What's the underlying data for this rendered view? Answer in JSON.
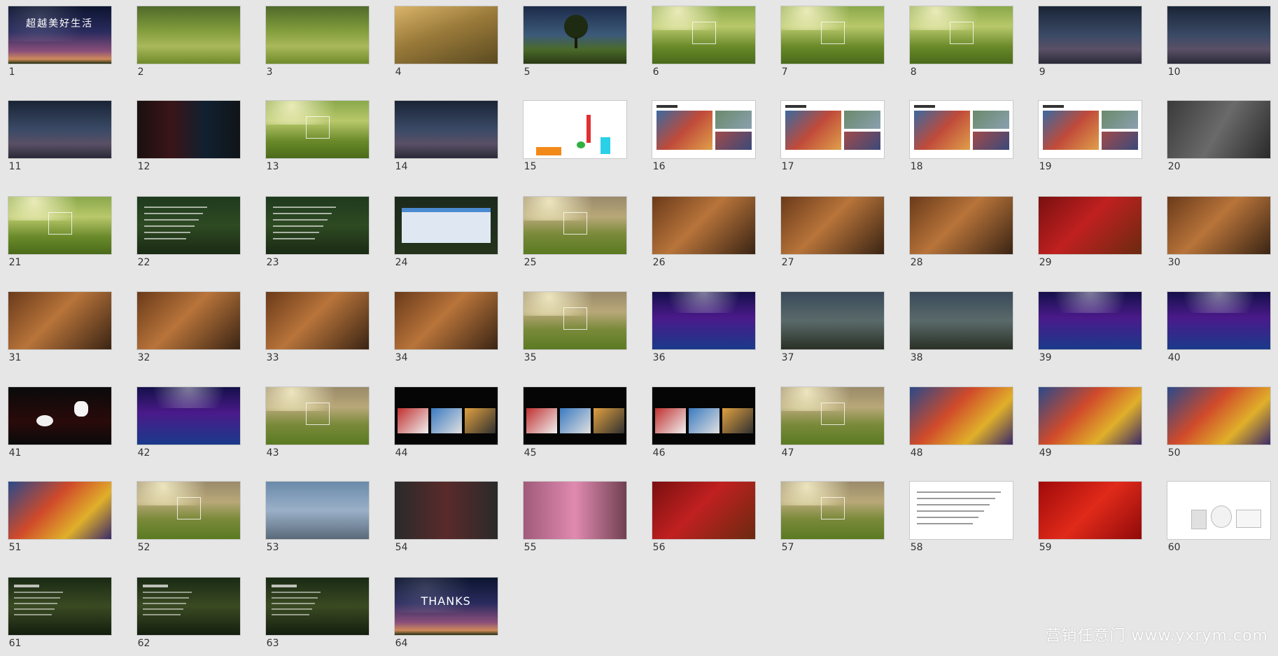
{
  "slides": [
    {
      "n": "1",
      "kind": "night",
      "title": "超越美好生活"
    },
    {
      "n": "2",
      "kind": "park",
      "title": ""
    },
    {
      "n": "3",
      "kind": "park",
      "title": ""
    },
    {
      "n": "4",
      "kind": "autumn",
      "title": ""
    },
    {
      "n": "5",
      "kind": "tree",
      "title": ""
    },
    {
      "n": "6",
      "kind": "forest",
      "title": ""
    },
    {
      "n": "7",
      "kind": "forest",
      "title": ""
    },
    {
      "n": "8",
      "kind": "forest",
      "title": ""
    },
    {
      "n": "9",
      "kind": "city",
      "title": ""
    },
    {
      "n": "10",
      "kind": "city",
      "title": ""
    },
    {
      "n": "11",
      "kind": "city",
      "title": ""
    },
    {
      "n": "12",
      "kind": "darkposter",
      "title": ""
    },
    {
      "n": "13",
      "kind": "forest",
      "title": ""
    },
    {
      "n": "14",
      "kind": "city",
      "title": ""
    },
    {
      "n": "15",
      "kind": "map",
      "title": ""
    },
    {
      "n": "16",
      "kind": "photowhite",
      "title": ""
    },
    {
      "n": "17",
      "kind": "photowhite",
      "title": ""
    },
    {
      "n": "18",
      "kind": "photowhite",
      "title": ""
    },
    {
      "n": "19",
      "kind": "photowhite",
      "title": ""
    },
    {
      "n": "20",
      "kind": "dining",
      "title": ""
    },
    {
      "n": "21",
      "kind": "forest",
      "title": ""
    },
    {
      "n": "22",
      "kind": "textgreen",
      "title": ""
    },
    {
      "n": "23",
      "kind": "textgreen",
      "title": ""
    },
    {
      "n": "24",
      "kind": "table",
      "title": ""
    },
    {
      "n": "25",
      "kind": "meadow",
      "title": ""
    },
    {
      "n": "26",
      "kind": "food",
      "title": ""
    },
    {
      "n": "27",
      "kind": "food",
      "title": ""
    },
    {
      "n": "28",
      "kind": "food",
      "title": ""
    },
    {
      "n": "29",
      "kind": "redfood",
      "title": ""
    },
    {
      "n": "30",
      "kind": "food",
      "title": ""
    },
    {
      "n": "31",
      "kind": "food",
      "title": ""
    },
    {
      "n": "32",
      "kind": "food",
      "title": ""
    },
    {
      "n": "33",
      "kind": "food",
      "title": ""
    },
    {
      "n": "34",
      "kind": "food",
      "title": ""
    },
    {
      "n": "35",
      "kind": "meadow",
      "title": ""
    },
    {
      "n": "36",
      "kind": "stage",
      "title": ""
    },
    {
      "n": "37",
      "kind": "band",
      "title": ""
    },
    {
      "n": "38",
      "kind": "band",
      "title": ""
    },
    {
      "n": "39",
      "kind": "stage",
      "title": ""
    },
    {
      "n": "40",
      "kind": "stage",
      "title": ""
    },
    {
      "n": "41",
      "kind": "magic",
      "title": ""
    },
    {
      "n": "42",
      "kind": "stage",
      "title": ""
    },
    {
      "n": "43",
      "kind": "meadow",
      "title": ""
    },
    {
      "n": "44",
      "kind": "blackcollage",
      "title": ""
    },
    {
      "n": "45",
      "kind": "blackcollage",
      "title": ""
    },
    {
      "n": "46",
      "kind": "blackcollage",
      "title": ""
    },
    {
      "n": "47",
      "kind": "meadow",
      "title": ""
    },
    {
      "n": "48",
      "kind": "carnival",
      "title": ""
    },
    {
      "n": "49",
      "kind": "carnival",
      "title": ""
    },
    {
      "n": "50",
      "kind": "carnival",
      "title": ""
    },
    {
      "n": "51",
      "kind": "carnival",
      "title": ""
    },
    {
      "n": "52",
      "kind": "meadow",
      "title": ""
    },
    {
      "n": "53",
      "kind": "event",
      "title": ""
    },
    {
      "n": "54",
      "kind": "shopfront",
      "title": ""
    },
    {
      "n": "55",
      "kind": "pinkstreet",
      "title": ""
    },
    {
      "n": "56",
      "kind": "redfood",
      "title": ""
    },
    {
      "n": "57",
      "kind": "meadow",
      "title": ""
    },
    {
      "n": "58",
      "kind": "whitetext",
      "title": ""
    },
    {
      "n": "59",
      "kind": "redenvelope",
      "title": ""
    },
    {
      "n": "60",
      "kind": "whiteproducts",
      "title": ""
    },
    {
      "n": "61",
      "kind": "darkforest",
      "title": ""
    },
    {
      "n": "62",
      "kind": "darkforest",
      "title": ""
    },
    {
      "n": "63",
      "kind": "darkforest",
      "title": ""
    },
    {
      "n": "64",
      "kind": "night",
      "title": "THANKS"
    }
  ],
  "watermark": "营销任意门 www.yxrym.com"
}
